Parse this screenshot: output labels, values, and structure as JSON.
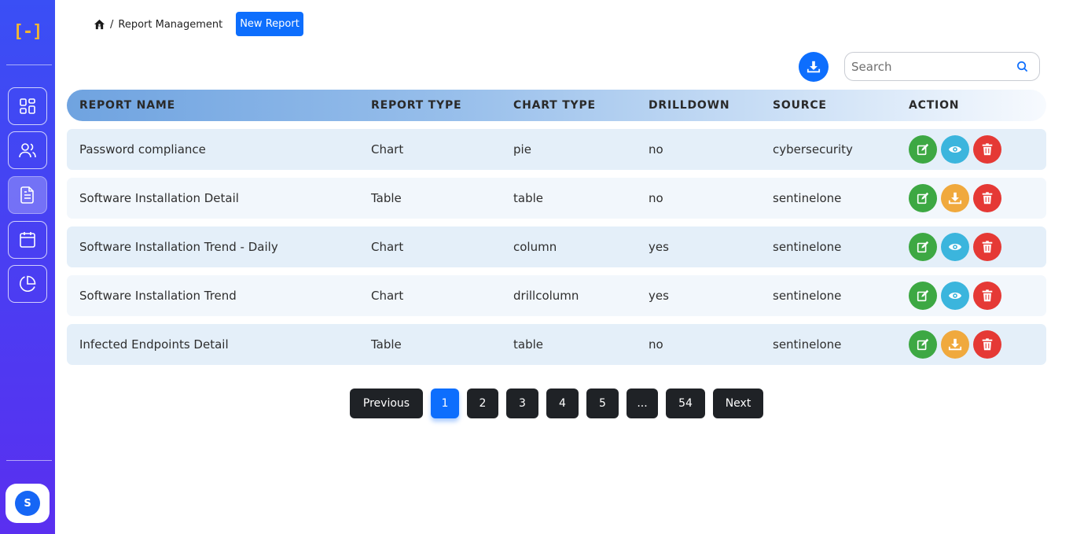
{
  "sidebar": {
    "logo_text": "[-]",
    "nav_items": [
      {
        "name": "dashboard",
        "icon": "grid-icon"
      },
      {
        "name": "users",
        "icon": "users-icon"
      },
      {
        "name": "reports",
        "icon": "document-icon",
        "active": true
      },
      {
        "name": "calendar",
        "icon": "calendar-icon"
      },
      {
        "name": "analytics",
        "icon": "pie-chart-icon"
      }
    ],
    "avatar_initial": "S"
  },
  "breadcrumb": {
    "home_icon": "home-icon",
    "separator": "/",
    "current": "Report Management"
  },
  "toolbar": {
    "new_report_label": "New Report",
    "download_icon": "download-icon"
  },
  "search": {
    "placeholder": "Search",
    "value": "",
    "icon": "search-icon"
  },
  "table": {
    "headers": [
      "REPORT NAME",
      "REPORT TYPE",
      "CHART TYPE",
      "DRILLDOWN",
      "SOURCE",
      "ACTION"
    ],
    "rows": [
      {
        "name": "Password compliance",
        "report_type": "Chart",
        "chart_type": "pie",
        "drilldown": "no",
        "source": "cybersecurity",
        "actions": [
          "edit",
          "view",
          "delete"
        ]
      },
      {
        "name": "Software Installation Detail",
        "report_type": "Table",
        "chart_type": "table",
        "drilldown": "no",
        "source": "sentinelone",
        "actions": [
          "edit",
          "download",
          "delete"
        ]
      },
      {
        "name": "Software Installation Trend - Daily",
        "report_type": "Chart",
        "chart_type": "column",
        "drilldown": "yes",
        "source": "sentinelone",
        "actions": [
          "edit",
          "view",
          "delete"
        ]
      },
      {
        "name": "Software Installation Trend",
        "report_type": "Chart",
        "chart_type": "drillcolumn",
        "drilldown": "yes",
        "source": "sentinelone",
        "actions": [
          "edit",
          "view",
          "delete"
        ]
      },
      {
        "name": "Infected Endpoints Detail",
        "report_type": "Table",
        "chart_type": "table",
        "drilldown": "no",
        "source": "sentinelone",
        "actions": [
          "edit",
          "download",
          "delete"
        ]
      }
    ]
  },
  "pagination": {
    "previous": "Previous",
    "pages": [
      "1",
      "2",
      "3",
      "4",
      "5",
      "...",
      "54"
    ],
    "current_page": "1",
    "next": "Next"
  },
  "colors": {
    "primary": "#0d6efd",
    "edit": "#3da843",
    "view": "#3bb5dd",
    "download": "#f0a93d",
    "delete": "#e53935",
    "logo": "#f2b632"
  }
}
